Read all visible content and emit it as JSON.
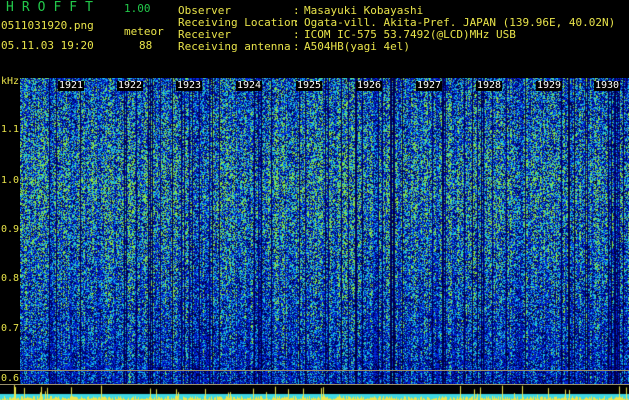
{
  "app": {
    "title": "HROFFT",
    "version": "1.00"
  },
  "file": {
    "name": "0511031920.png",
    "mode": "meteor",
    "timestamp": "05.11.03 19:20",
    "count": "88"
  },
  "info": [
    {
      "label": "Observer",
      "value": "Masayuki Kobayashi"
    },
    {
      "label": "Receiving Location",
      "value": "Ogata-vill. Akita-Pref. JAPAN (139.96E, 40.02N)"
    },
    {
      "label": "Receiver",
      "value": "ICOM IC-575 53.7492(@LCD)MHz USB"
    },
    {
      "label": "Receiving antenna",
      "value": "A504HB(yagi 4el)"
    }
  ],
  "axis": {
    "y_unit": "kHz",
    "y_ticks": [
      "1.1",
      "1.0",
      "0.9",
      "0.8",
      "0.7",
      "0.6"
    ],
    "x_ticks": [
      "1921",
      "1922",
      "1923",
      "1924",
      "1925",
      "1926",
      "1927",
      "1928",
      "1929",
      "1930"
    ]
  },
  "colors": {
    "label": "#e8e34a",
    "title": "#22c84a",
    "background": "#000000"
  }
}
